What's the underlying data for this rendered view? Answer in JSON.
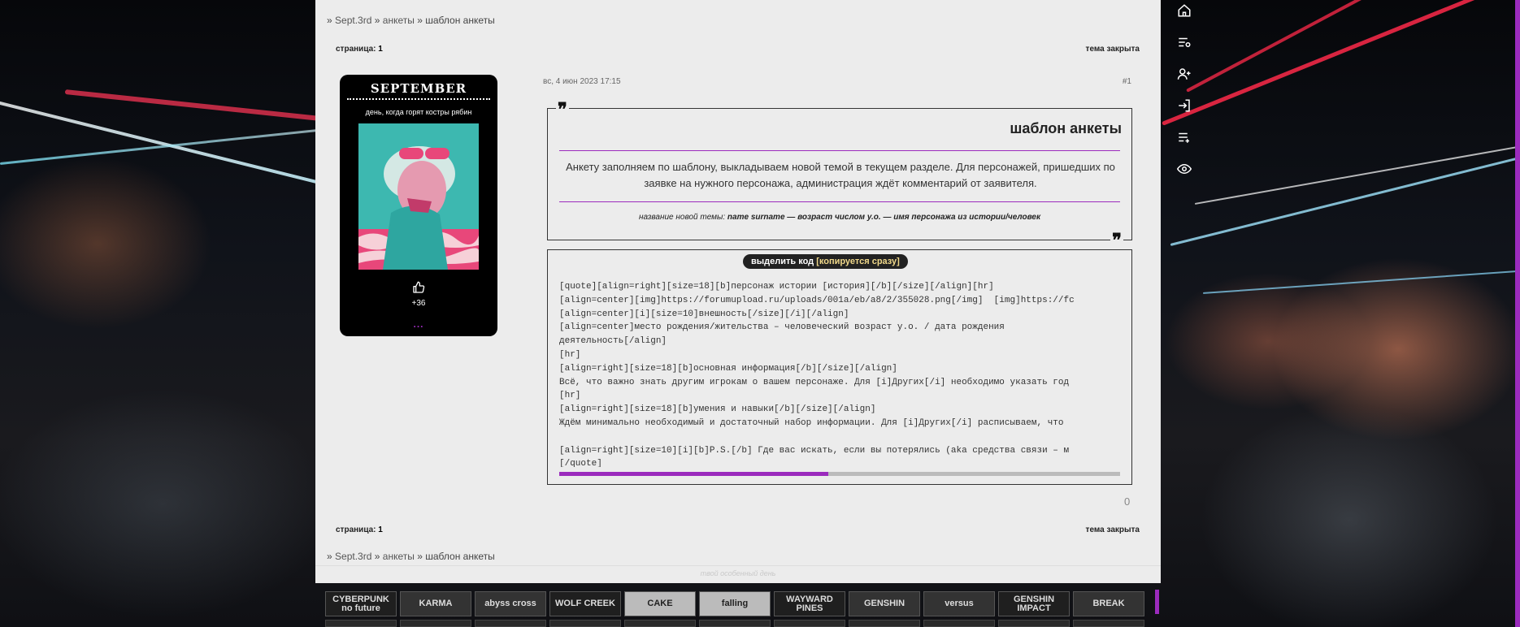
{
  "colors": {
    "accent": "#9b2bbd",
    "panel": "#ececec",
    "dark": "#000000"
  },
  "breadcrumb": {
    "sep": "»",
    "items": [
      "Sept.3rd",
      "анкеты",
      "шаблон анкеты"
    ]
  },
  "pagination": {
    "label": "страница:",
    "current": "1"
  },
  "topic_status": "тема закрыта",
  "author": {
    "name": "SEPTEMBER",
    "subtitle": "день, когда горят костры рябин",
    "likes_icon": "thumbs-up-icon",
    "likes": "+36",
    "more": "..."
  },
  "post": {
    "date": "вс, 4 июн 2023 17:15",
    "number": "#1",
    "quote_mark": "❞",
    "title": "шаблон анкеты",
    "text": "Анкету заполняем по шаблону, выкладываем новой темой в текущем разделе. Для персонажей, пришедших по заявке на нужного персонажа, администрация ждёт комментарий от заявителя.",
    "footer_label": "название новой темы:",
    "footer_value": "name surname — возраст числом у.о. — имя персонажа из истории/человек",
    "code_button": "выделить код",
    "code_button_hint": "[копируется сразу]",
    "code_lines": [
      "[quote][align=right][size=18][b]персонаж истории [история][/b][/size][/align][hr]",
      "[align=center][img]https://forumupload.ru/uploads/001a/eb/a8/2/355028.png[/img]  [img]https://fc",
      "[align=center][i][size=10]внешность[/size][/i][/align]",
      "[align=center]место рождения/жительства – человеческий возраст у.о. / дата рождения",
      "деятельность[/align]",
      "[hr]",
      "[align=right][size=18][b]основная информация[/b][/size][/align]",
      "Всё, что важно знать другим игрокам о вашем персонаже. Для [i]Других[/i] необходимо указать год",
      "[hr]",
      "[align=right][size=18][b]умения и навыки[/b][/size][/align]",
      "Ждём минимально необходимый и достаточный набор информации. Для [i]Других[/i] расписываем, что",
      "",
      "[align=right][size=10][i][b]P.S.[/b] Где вас искать, если вы потерялись (aka средства связи – м",
      "[/quote]"
    ],
    "scroll_fraction": 0.48
  },
  "rating": "0",
  "footer_note": "твой особенный день",
  "banners": [
    "CYBERPUNK no future",
    "KARMA",
    "abyss cross",
    "WOLF CREEK",
    "CAKE",
    "falling",
    "WAYWARD PINES",
    "GENSHIN",
    "versus",
    "GENSHIN IMPACT",
    "BREAK"
  ],
  "right_menu": [
    "home-icon",
    "list-settings-icon",
    "add-user-icon",
    "login-icon",
    "add-list-icon",
    "eye-icon"
  ]
}
